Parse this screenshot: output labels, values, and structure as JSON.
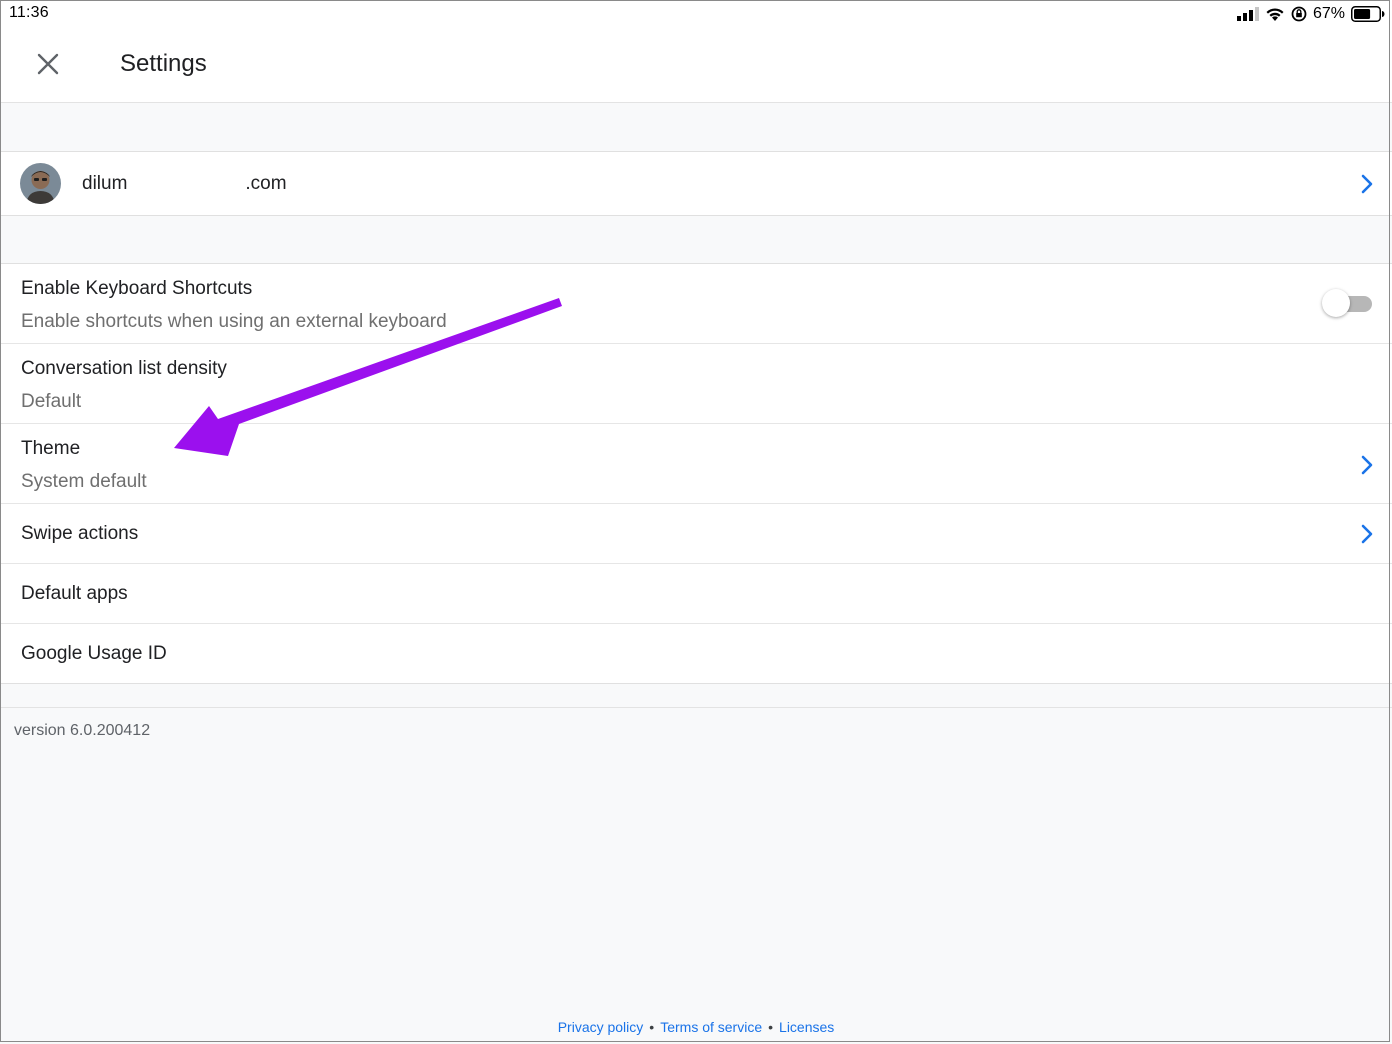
{
  "status_bar": {
    "time": "11:36",
    "battery_percent": "67%",
    "battery_level": 0.67,
    "icons": [
      "cellular-signal-icon",
      "wifi-icon",
      "orientation-lock-icon",
      "battery-icon"
    ]
  },
  "header": {
    "title": "Settings",
    "close_icon": "close-icon"
  },
  "account": {
    "email_prefix": "dilum",
    "email_suffix": ".com",
    "chevron_icon": "chevron-right-icon"
  },
  "settings": {
    "keyboard_shortcuts": {
      "title": "Enable Keyboard Shortcuts",
      "subtitle": "Enable shortcuts when using an external keyboard",
      "enabled": false
    },
    "density": {
      "title": "Conversation list density",
      "subtitle": "Default"
    },
    "theme": {
      "title": "Theme",
      "subtitle": "System default"
    },
    "swipe_actions": {
      "title": "Swipe actions"
    },
    "default_apps": {
      "title": "Default apps"
    },
    "usage_id": {
      "title": "Google Usage ID"
    }
  },
  "version": "version 6.0.200412",
  "footer": {
    "privacy": "Privacy policy",
    "terms": "Terms of service",
    "licenses": "Licenses"
  },
  "colors": {
    "accent": "#1a73e8",
    "annotation_arrow": "#9b10ee",
    "background": "#f8f9fa"
  }
}
